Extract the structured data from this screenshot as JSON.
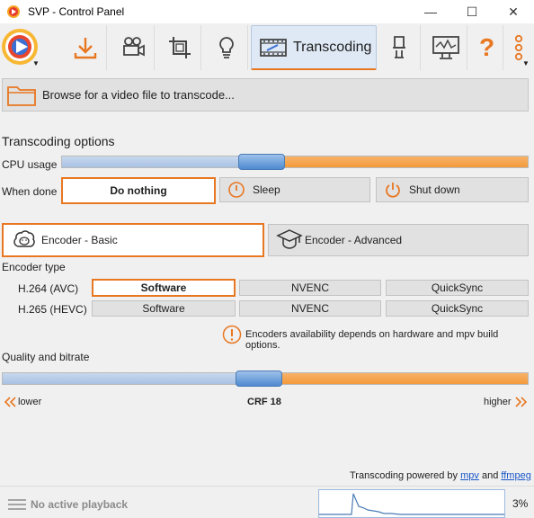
{
  "window": {
    "title": "SVP - Control Panel",
    "minimize": "—",
    "maximize": "☐",
    "close": "✕"
  },
  "toolbar": {
    "icons": [
      "svp-logo-icon",
      "download-icon",
      "camera-icon",
      "crop-icon",
      "lightbulb-icon",
      "transcoding-icon",
      "lamp-icon",
      "monitor-icon",
      "help-icon",
      "more-icon"
    ],
    "active_label": "Transcoding",
    "accent": "#e87722"
  },
  "browse": {
    "label": "Browse for a video file to transcode..."
  },
  "transcoding": {
    "title": "Transcoding options",
    "cpu_usage_label": "CPU usage",
    "cpu_usage_level": 0.43,
    "when_done_label": "When done",
    "when_done_options": [
      "Do nothing",
      "Sleep",
      "Shut down"
    ],
    "when_done_selected": "Do nothing"
  },
  "encoder": {
    "modes": [
      "Encoder - Basic",
      "Encoder - Advanced"
    ],
    "selected_mode": "Encoder - Basic",
    "type_label": "Encoder type",
    "rows": [
      {
        "codec": "H.264 (AVC)",
        "options": [
          "Software",
          "NVENC",
          "QuickSync"
        ],
        "selected": "Software"
      },
      {
        "codec": "H.265 (HEVC)",
        "options": [
          "Software",
          "NVENC",
          "QuickSync"
        ],
        "selected": ""
      }
    ],
    "note": "Encoders availability depends on hardware and mpv build options."
  },
  "quality": {
    "title": "Quality and bitrate",
    "level": 0.49,
    "lower": "lower",
    "value": "CRF 18",
    "higher": "higher"
  },
  "footer": {
    "powered_prefix": "Transcoding powered by",
    "mpv": "mpv",
    "and": "and",
    "ffmpeg": "ffmpeg"
  },
  "status": {
    "playback": "No active playback",
    "cpu_percent": "3%"
  }
}
